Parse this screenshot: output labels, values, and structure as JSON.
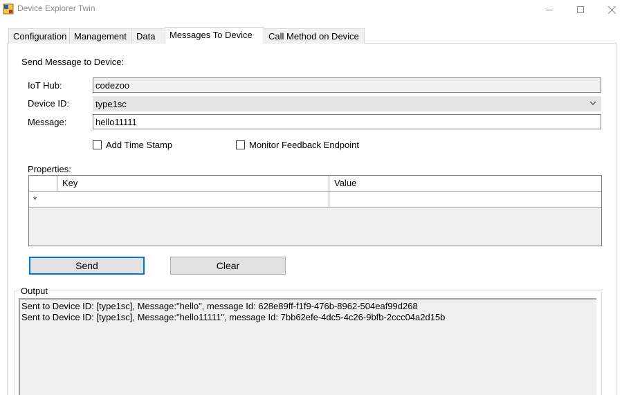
{
  "window": {
    "title": "Device Explorer Twin",
    "controls": {
      "minimize": "minimize-icon",
      "maximize": "maximize-icon",
      "close": "close-icon"
    }
  },
  "tabs": [
    {
      "label": "Configuration",
      "active": false
    },
    {
      "label": "Management",
      "active": false
    },
    {
      "label": "Data",
      "active": false
    },
    {
      "label": "Messages To Device",
      "active": true
    },
    {
      "label": "Call Method on Device",
      "active": false
    }
  ],
  "form": {
    "section_title": "Send Message to Device:",
    "iot_hub_label": "IoT Hub:",
    "iot_hub_value": "codezoo",
    "device_id_label": "Device ID:",
    "device_id_value": "type1sc",
    "message_label": "Message:",
    "message_value": "hello11111",
    "add_timestamp_label": "Add Time Stamp",
    "add_timestamp_checked": false,
    "monitor_feedback_label": "Monitor Feedback Endpoint",
    "monitor_feedback_checked": false
  },
  "properties": {
    "label": "Properties:",
    "columns": [
      "Key",
      "Value"
    ],
    "new_row_marker": "*"
  },
  "buttons": {
    "send": "Send",
    "clear": "Clear"
  },
  "output": {
    "label": "Output",
    "lines": [
      "Sent to Device ID: [type1sc], Message:\"hello\", message Id: 628e89ff-f1f9-476b-8962-504eaf99d268",
      "Sent to Device ID: [type1sc], Message:\"hello11111\", message Id: 7bb62efe-4dc5-4c26-9bfb-2ccc04a2d15b"
    ]
  },
  "colors": {
    "accent": "#0078d7",
    "control_face": "#e1e1e1",
    "readonly_bg": "#f0f0f0"
  }
}
